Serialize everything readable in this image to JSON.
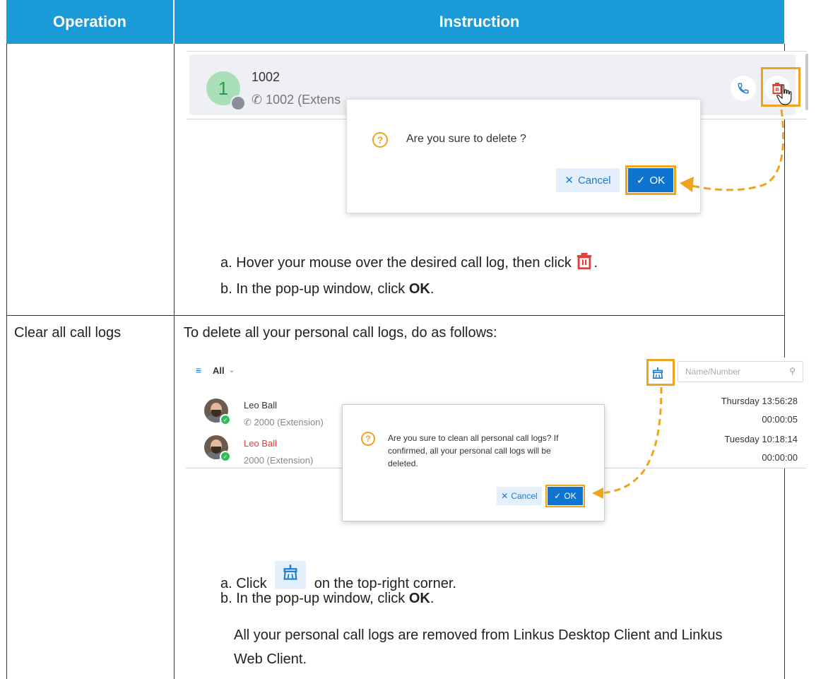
{
  "header": {
    "operation": "Operation",
    "instruction": "Instruction"
  },
  "delete_one": {
    "contact_initial": "1",
    "contact_name": "1002",
    "contact_sub": "1002 (Extens",
    "dialog_message": "Are you sure to delete ?",
    "cancel_label": "Cancel",
    "ok_label": "OK",
    "step_a": "a. Hover your mouse over the desired call log, then click",
    "step_a_end": ".",
    "step_b_prefix": "b. In the pop-up window, click ",
    "step_b_bold": "OK",
    "step_b_end": "."
  },
  "clear_all": {
    "operation_label": "Clear all call logs",
    "intro": "To delete all your personal call logs, do as follows:",
    "filter_label": "All",
    "search_placeholder": "Name/Number",
    "logs": [
      {
        "name": "Leo Ball",
        "number": "2000 (Extension)",
        "time": "Thursday 13:56:28",
        "duration": "00:00:05",
        "missed": false
      },
      {
        "name": "Leo Ball",
        "number": "2000 (Extension)",
        "time": "Tuesday 10:18:14",
        "duration": "00:00:00",
        "missed": true
      }
    ],
    "dialog_message": "Are you sure to clean all personal call logs? If confirmed, all your personal call logs will be deleted.",
    "cancel_label": "Cancel",
    "ok_label": "OK",
    "step_a_prefix": "a. Click",
    "step_a_suffix": "on the top-right corner.",
    "step_b_prefix": "b. In the pop-up window, click ",
    "step_b_bold": "OK",
    "step_b_end": ".",
    "result": "All your personal call logs are removed from Linkus Desktop Client and Linkus Web Client."
  },
  "colors": {
    "header_bg": "#1a9ad6",
    "highlight": "#f0a31c",
    "primary": "#0f74cf",
    "delete_red": "#e0403a"
  },
  "icons": [
    "trash-icon",
    "phone-icon",
    "question-icon",
    "broom-icon",
    "search-icon",
    "filter-icon",
    "check-icon",
    "close-icon",
    "cursor-hand-icon"
  ]
}
